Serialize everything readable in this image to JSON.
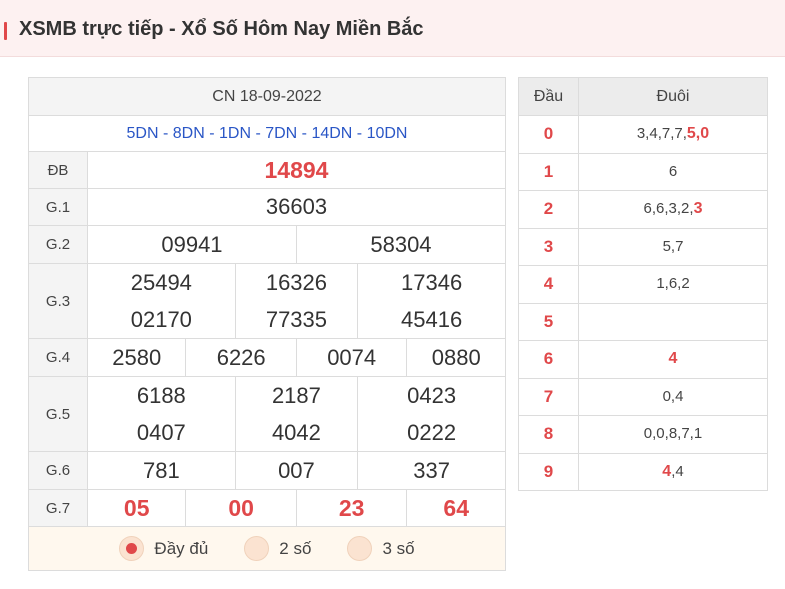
{
  "header": {
    "title": "XSMB trực tiếp - Xổ Số Hôm Nay Miền Bắc"
  },
  "results": {
    "date": "CN 18-09-2022",
    "codes": "5DN - 8DN - 1DN - 7DN - 14DN - 10DN",
    "labels": {
      "db": "ĐB",
      "g1": "G.1",
      "g2": "G.2",
      "g3": "G.3",
      "g4": "G.4",
      "g5": "G.5",
      "g6": "G.6",
      "g7": "G.7"
    },
    "db": "14894",
    "g1": "36603",
    "g2": [
      "09941",
      "58304"
    ],
    "g3": [
      "25494",
      "16326",
      "17346",
      "02170",
      "77335",
      "45416"
    ],
    "g4": [
      "2580",
      "6226",
      "0074",
      "0880"
    ],
    "g5": [
      "6188",
      "2187",
      "0423",
      "0407",
      "4042",
      "0222"
    ],
    "g6": [
      "781",
      "007",
      "337"
    ],
    "g7": [
      "05",
      "00",
      "23",
      "64"
    ]
  },
  "filter": {
    "options": [
      "Đầy đủ",
      "2 số",
      "3 số"
    ],
    "selected": "Đầy đủ"
  },
  "loto": {
    "col_head": "Đầu",
    "col_tail": "Đuôi",
    "rows": [
      {
        "head": "0",
        "tail": "3,4,7,7,",
        "hl": "5,0"
      },
      {
        "head": "1",
        "tail": "6",
        "hl": ""
      },
      {
        "head": "2",
        "tail": "6,6,3,2,",
        "hl": "3"
      },
      {
        "head": "3",
        "tail": "5,7",
        "hl": ""
      },
      {
        "head": "4",
        "tail": "1,6,2",
        "hl": ""
      },
      {
        "head": "5",
        "tail": "",
        "hl": ""
      },
      {
        "head": "6",
        "tail": "",
        "hl": "4"
      },
      {
        "head": "7",
        "tail": "0,4",
        "hl": ""
      },
      {
        "head": "8",
        "tail": "0,0,8,7,1",
        "hl": ""
      },
      {
        "head": "9",
        "hl": "4",
        "tail_after": ",4"
      }
    ]
  },
  "colors": {
    "accent": "#e0484a",
    "code_blue": "#2a56c6",
    "header_bg": "#fdf1f1"
  }
}
